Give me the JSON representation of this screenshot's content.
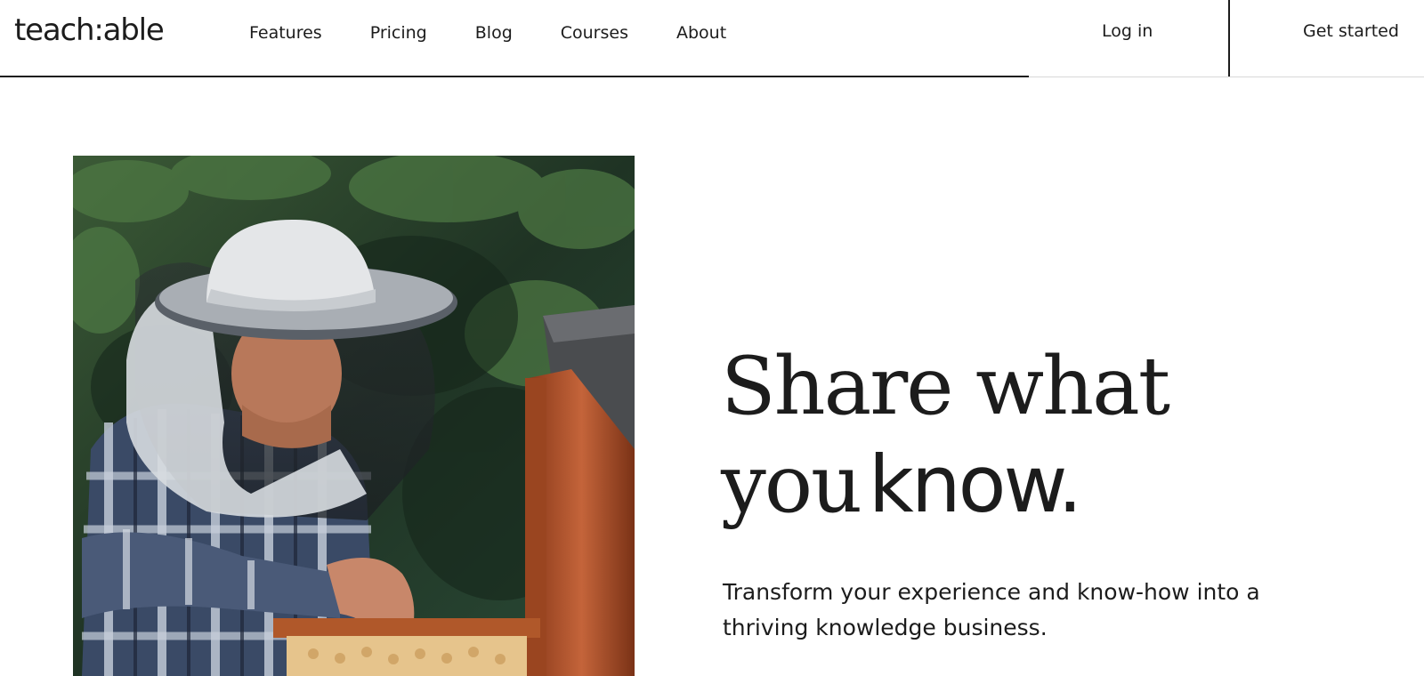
{
  "header": {
    "logo": "teach:able",
    "nav": [
      "Features",
      "Pricing",
      "Blog",
      "Courses",
      "About"
    ],
    "login_label": "Log in",
    "cta_label": "Get started"
  },
  "hero": {
    "headline_line1": "Share what",
    "headline_line2_serif": "you",
    "headline_line2_sans": "know.",
    "subhead": "Transform your experience and know-how into a thriving knowledge business.",
    "image": "beekeeper-photo"
  },
  "colors": {
    "text": "#1c1c1c",
    "background": "#ffffff",
    "foliage": "#233a26",
    "wood": "#b4542a"
  }
}
